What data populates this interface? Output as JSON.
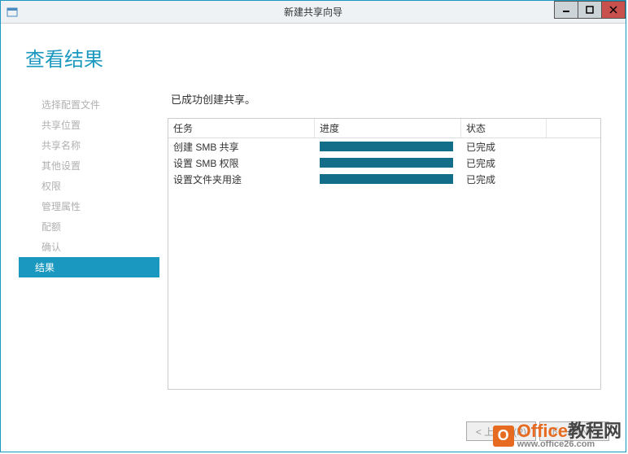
{
  "titlebar": {
    "title": "新建共享向导"
  },
  "page": {
    "title": "查看结果"
  },
  "sidebar": {
    "items": [
      {
        "label": "选择配置文件",
        "active": false
      },
      {
        "label": "共享位置",
        "active": false
      },
      {
        "label": "共享名称",
        "active": false
      },
      {
        "label": "其他设置",
        "active": false
      },
      {
        "label": "权限",
        "active": false
      },
      {
        "label": "管理属性",
        "active": false
      },
      {
        "label": "配额",
        "active": false
      },
      {
        "label": "确认",
        "active": false
      },
      {
        "label": "结果",
        "active": true
      }
    ]
  },
  "main": {
    "heading": "已成功创建共享。",
    "columns": {
      "task": "任务",
      "progress": "进度",
      "status": "状态"
    },
    "rows": [
      {
        "task": "创建 SMB 共享",
        "status": "已完成"
      },
      {
        "task": "设置 SMB 权限",
        "status": "已完成"
      },
      {
        "task": "设置文件夹用途",
        "status": "已完成"
      }
    ]
  },
  "footer": {
    "prev": "< 上一步(P)",
    "next": "下一步(N) >"
  },
  "watermark": {
    "text1": "Office",
    "text2": "教程网",
    "url": "www.office26.com"
  }
}
